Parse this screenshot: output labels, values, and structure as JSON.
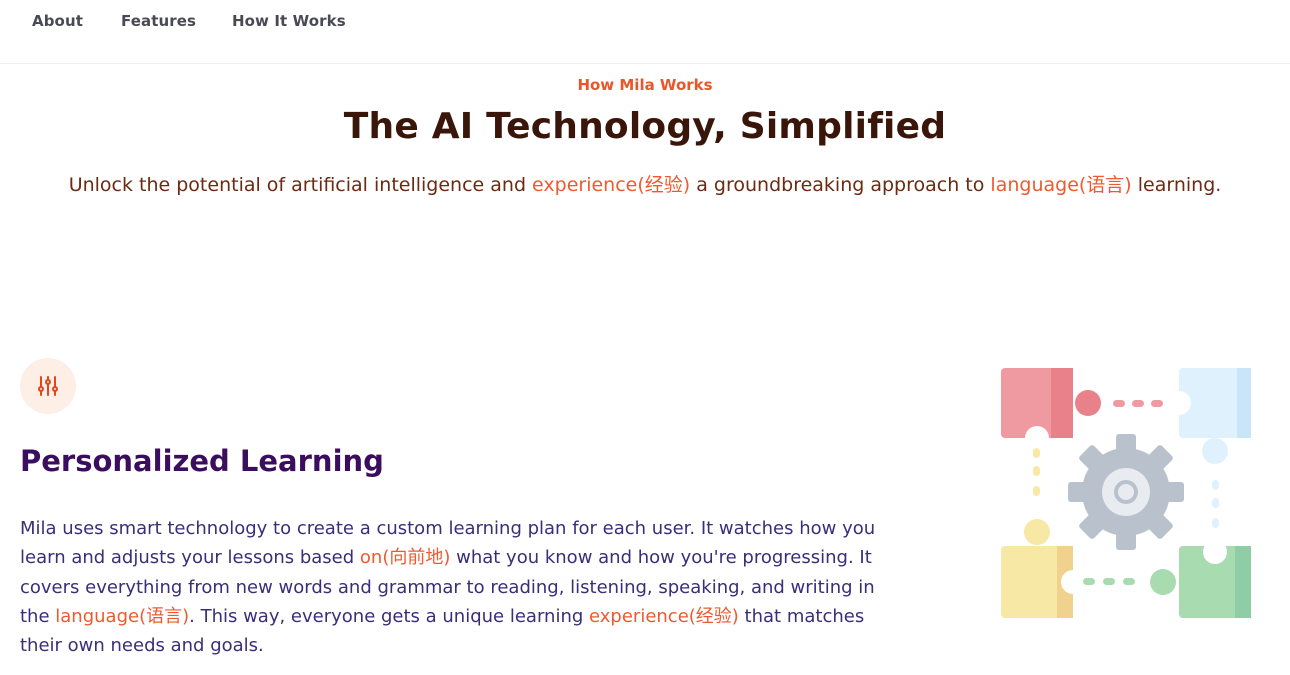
{
  "nav": {
    "items": [
      "About",
      "Features",
      "How It Works"
    ]
  },
  "hero": {
    "eyebrow": "How Mila Works",
    "title": "The AI Technology, Simplified",
    "subtitle": {
      "part1": "Unlock the potential of artificial intelligence and ",
      "hl1": "experience(经验)",
      "part2": " a groundbreaking approach to ",
      "hl2": "language(语言)",
      "part3": " learning."
    }
  },
  "feature": {
    "icon": "sliders-icon",
    "title": "Personalized Learning",
    "body": {
      "part1": "Mila uses smart technology to create a custom learning plan for each user. It watches how you learn and adjusts your lessons based ",
      "hl1": "on(向前地)",
      "part2": " what you know and how you're progressing. It covers everything from new words and grammar to reading, listening, speaking, and writing in the ",
      "hl2": "language(语言)",
      "part3": ". This way, everyone gets a unique learning ",
      "hl3": "experience(经验)",
      "part4": " that matches their own needs and goals."
    },
    "illustration": "puzzle-gear-illustration"
  },
  "colors": {
    "accent": "#ee5a2f",
    "title_dark": "#3a160a",
    "feature_title": "#3b0d5e",
    "body_text": "#3a2e7a"
  }
}
